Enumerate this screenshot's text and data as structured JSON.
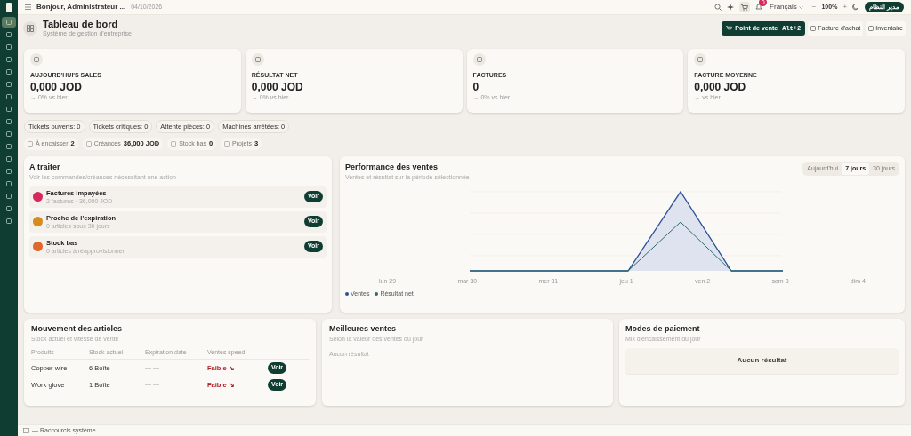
{
  "sidebar": {
    "items": [
      {
        "selected": true
      },
      {
        "selected": false
      },
      {
        "selected": false
      },
      {
        "selected": false
      },
      {
        "selected": false
      },
      {
        "selected": false
      },
      {
        "selected": false
      },
      {
        "selected": false
      },
      {
        "selected": false
      },
      {
        "selected": false
      },
      {
        "selected": false
      },
      {
        "selected": false
      },
      {
        "selected": false
      },
      {
        "selected": false
      },
      {
        "selected": false
      },
      {
        "selected": false
      },
      {
        "selected": false
      }
    ]
  },
  "topbar": {
    "greeting": "Bonjour, Administrateur ...",
    "date": "04/10/2026",
    "notifications": "0",
    "language": "Français",
    "zoom_minus": "−",
    "zoom": "100%",
    "zoom_plus": "+",
    "user": "مدير النظام"
  },
  "header": {
    "title": "Tableau de bord",
    "subtitle": "Système de gestion d'entreprise",
    "actions": [
      {
        "kind": "primary",
        "label": "Point de vente",
        "shortcut": "Alt+2"
      },
      {
        "kind": "plain",
        "label": "Facture d'achat"
      },
      {
        "kind": "plain",
        "label": "Inventaire"
      }
    ]
  },
  "kpis": [
    {
      "label": "AUJOURD'HUI'S SALES",
      "value": "0,000 JOD",
      "delta": "→ 0% vs hier"
    },
    {
      "label": "RÉSULTAT NET",
      "value": "0,000 JOD",
      "delta": "→ 0% vs hier"
    },
    {
      "label": "FACTURES",
      "value": "0",
      "delta": "→ 0% vs hier"
    },
    {
      "label": "FACTURE MOYENNE",
      "value": "0,000 JOD",
      "delta": "→ vs hier"
    }
  ],
  "chips": [
    "Tickets ouverts: 0",
    "Tickets critiques: 0",
    "Attente pièces: 0",
    "Machines arrêtées: 0"
  ],
  "stats": [
    {
      "label": "À encaisser",
      "value": "2"
    },
    {
      "label": "Créances",
      "value": "36,000 JOD"
    },
    {
      "label": "Stock bas",
      "value": "0"
    },
    {
      "label": "Projets",
      "value": "3"
    }
  ],
  "todo": {
    "title": "À traiter",
    "subtitle": "Voir les commandes/créances nécessitant une action",
    "items": [
      {
        "title": "Factures impayées",
        "detail": "2 factures · 36,000 JOD",
        "color": "#d6285a",
        "button": "Voir"
      },
      {
        "title": "Proche de l'expiration",
        "detail": "0 articles sous 30 jours",
        "color": "#d98a1c",
        "button": "Voir"
      },
      {
        "title": "Stock bas",
        "detail": "0 articles à réapprovisionner",
        "color": "#e0672a",
        "button": "Voir"
      }
    ]
  },
  "performance": {
    "title": "Performance des ventes",
    "subtitle": "Ventes et résultat sur la période sélectionnée",
    "ranges": [
      {
        "label": "Aujourd'hui",
        "selected": false
      },
      {
        "label": "7 jours",
        "selected": true
      },
      {
        "label": "30 jours",
        "selected": false
      }
    ],
    "x_labels": [
      "lun 29",
      "mar 30",
      "mer 31",
      "jeu 1",
      "ven 2",
      "sam 3",
      "dim 4"
    ],
    "legend": [
      {
        "name": "Ventes",
        "color": "#2f4f96"
      },
      {
        "name": "Résultat net",
        "color": "#2b6b6b"
      }
    ]
  },
  "movement": {
    "title": "Mouvement des articles",
    "subtitle": "Stock actuel et vitesse de vente",
    "columns": [
      "Produits",
      "Stock actuel",
      "Expiration date",
      "Ventes speed"
    ],
    "rows": [
      {
        "product": "Copper wire",
        "stock": "6 Boîte",
        "expiry": "— —",
        "speed": "Faible ↘",
        "button": "Voir"
      },
      {
        "product": "Work glove",
        "stock": "1 Boîte",
        "expiry": "— —",
        "speed": "Faible ↘",
        "button": "Voir"
      }
    ]
  },
  "best": {
    "title": "Meilleures ventes",
    "subtitle": "Selon la valeur des ventes du jour",
    "empty": "Aucun résultat"
  },
  "payments": {
    "title": "Modes de paiement",
    "subtitle": "Mix d'encaissement du jour",
    "empty": "Aucun résultat"
  },
  "footer": {
    "label": "— Raccourcis système"
  }
}
